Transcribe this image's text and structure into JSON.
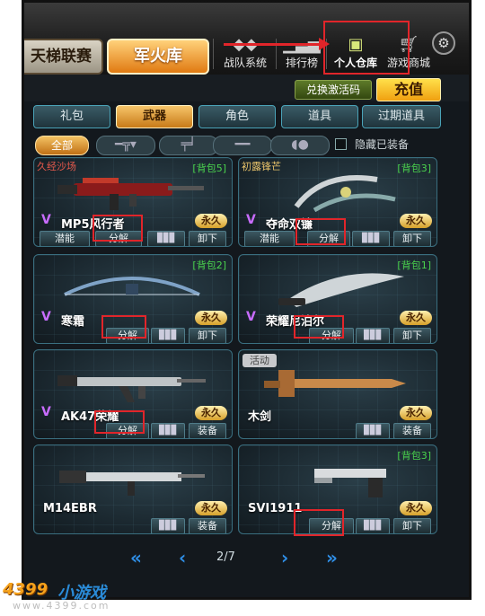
{
  "header": {
    "ladder": "天梯联赛",
    "arsenal": "军火库",
    "nav": [
      {
        "label": "战队系统",
        "icon": "team-icon"
      },
      {
        "label": "排行榜",
        "icon": "rank-icon"
      },
      {
        "label": "个人仓库",
        "icon": "warehouse-icon"
      },
      {
        "label": "游戏商城",
        "icon": "cart-icon"
      }
    ],
    "settings_icon": "gear-icon"
  },
  "actions": {
    "redeem": "兑换激活码",
    "charge": "充值"
  },
  "tabs": [
    "礼包",
    "武器",
    "角色",
    "道具",
    "过期道具"
  ],
  "active_tab": "武器",
  "filters": {
    "all": "全部",
    "icons": [
      "rifle-icon",
      "pistol-icon",
      "melee-icon",
      "grenade-icon"
    ],
    "hide_equipped": "隐藏已装备"
  },
  "cards": [
    {
      "tag": "久经沙场",
      "pack": "[背包5]",
      "name": "MP5风行者",
      "permanent": "永久",
      "buttons": [
        "潜能",
        "分解",
        "▊▊▊",
        "卸下"
      ]
    },
    {
      "tag": "初露锋芒",
      "pack": "[背包3]",
      "name": "夺命双镰",
      "permanent": "永久",
      "buttons": [
        "潜能",
        "分解",
        "▊▊▊",
        "卸下"
      ]
    },
    {
      "tag": "",
      "pack": "[背包2]",
      "name": "寒霜",
      "permanent": "永久",
      "buttons": [
        "分解",
        "▊▊▊",
        "卸下"
      ]
    },
    {
      "tag": "",
      "pack": "[背包1]",
      "name": "荣耀尼泊尔",
      "permanent": "永久",
      "buttons": [
        "分解",
        "▊▊▊",
        "卸下"
      ]
    },
    {
      "tag": "",
      "pack": "",
      "name": "AK47荣耀",
      "permanent": "永久",
      "buttons": [
        "分解",
        "▊▊▊",
        "装备"
      ]
    },
    {
      "tag": "活动",
      "pack": "",
      "name": "木剑",
      "permanent": "永久",
      "buttons": [
        "▊▊▊",
        "装备"
      ]
    },
    {
      "tag": "",
      "pack": "",
      "name": "M14EBR",
      "permanent": "永久",
      "buttons": [
        "▊▊▊",
        "装备"
      ]
    },
    {
      "tag": "",
      "pack": "[背包3]",
      "name": "SVI1911",
      "permanent": "永久",
      "buttons": [
        "分解",
        "▊▊▊",
        "卸下"
      ]
    }
  ],
  "pager": {
    "first": "«",
    "prev": "‹",
    "page": "2/7",
    "next": "›",
    "last": "»"
  },
  "watermark": {
    "brand_a": "4399",
    "brand_b": "小游戏",
    "url": "www.4399.com"
  }
}
